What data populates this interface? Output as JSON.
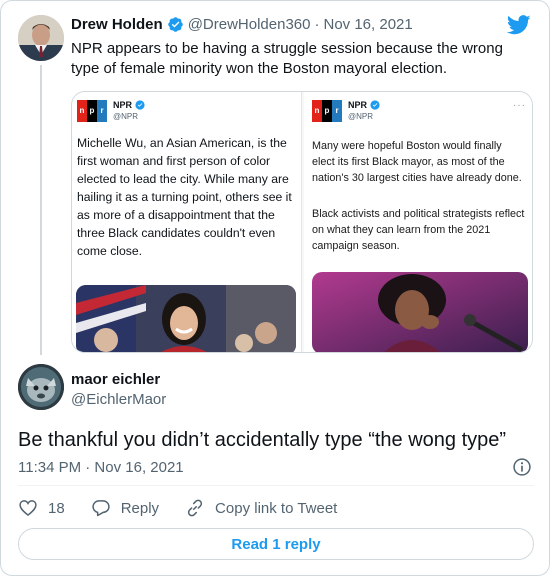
{
  "parent_tweet": {
    "author_name": "Drew Holden",
    "author_handle": "@DrewHolden360",
    "separator": "·",
    "date": "Nov 16, 2021",
    "text": "NPR appears to be having a struggle session because the wrong type of female minority won the Boston mayoral election.",
    "embedded_tweets": [
      {
        "logo_letters": [
          "n",
          "p",
          "r"
        ],
        "account_name": "NPR",
        "account_handle": "@NPR",
        "text": "Michelle Wu, an Asian American, is the first woman and first person of color elected to lead the city. While many are hailing it as a turning point, others see it as more of a disappointment that the three Black candidates couldn't even come close."
      },
      {
        "logo_letters": [
          "n",
          "p",
          "r"
        ],
        "account_name": "NPR",
        "account_handle": "@NPR",
        "more": "···",
        "text": "Many were hopeful Boston would finally elect its first Black mayor, as most of the nation's 30 largest cities have already done.",
        "text2": "Black activists and political strategists reflect on what they can learn from the 2021 campaign season."
      }
    ]
  },
  "reply_tweet": {
    "author_name": "maor eichler",
    "author_handle": "@EichlerMaor",
    "text": "Be thankful you didn’t accidentally type “the wong type”",
    "timestamp": "11:34 PM · Nov 16, 2021",
    "like_count": "18",
    "reply_label": "Reply",
    "copy_link_label": "Copy link to Tweet",
    "read_replies_label": "Read 1 reply"
  },
  "colors": {
    "accent": "#1d9bf0",
    "npr_red": "#e2231a",
    "npr_black": "#000000",
    "npr_blue": "#237bbd"
  },
  "icons": [
    "twitter-bird-icon",
    "verified-badge-icon",
    "heart-icon",
    "reply-icon",
    "link-icon",
    "info-icon"
  ]
}
